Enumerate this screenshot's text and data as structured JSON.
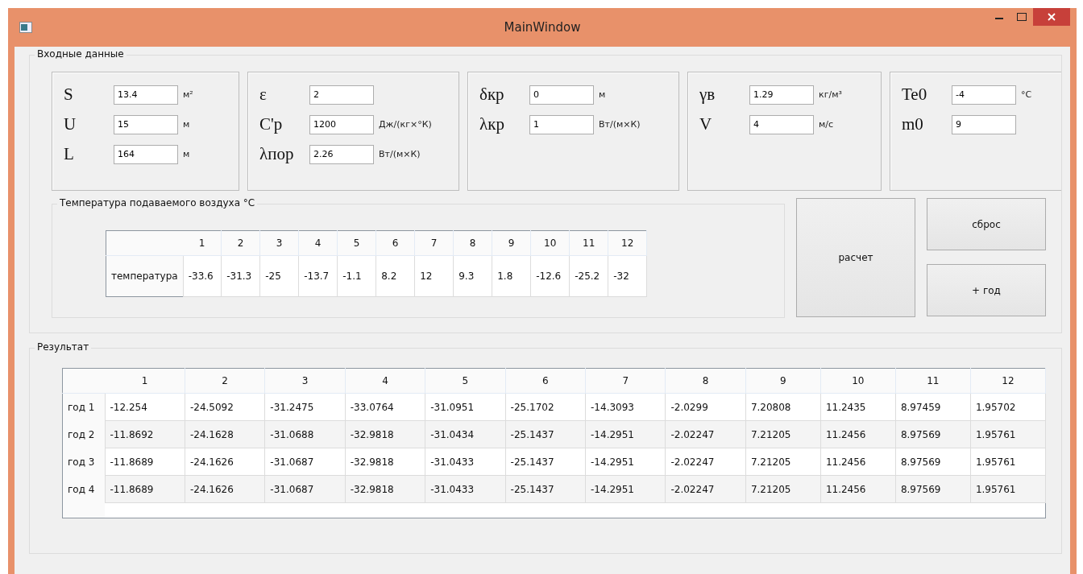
{
  "window": {
    "title": "MainWindow"
  },
  "input_section": {
    "title": "Входные данные",
    "panels": [
      {
        "fields": [
          {
            "label": "S",
            "value": "13.4",
            "unit": "м²"
          },
          {
            "label": "U",
            "value": "15",
            "unit": "м"
          },
          {
            "label": "L",
            "value": "164",
            "unit": "м"
          }
        ]
      },
      {
        "fields": [
          {
            "label": "ε",
            "value": "2"
          },
          {
            "label": "C'p",
            "value": "1200",
            "unit": "Дж/(кг×°К)"
          },
          {
            "label": "λпор",
            "value": "2.26",
            "unit": "Вт/(м×К)"
          }
        ]
      },
      {
        "fields": [
          {
            "label": "δкр",
            "value": "0",
            "unit": "м"
          },
          {
            "label": "λкр",
            "value": "1",
            "unit": "Вт/(м×К)"
          }
        ]
      },
      {
        "fields": [
          {
            "label": "γв",
            "value": "1.29",
            "unit": "кг/м³"
          },
          {
            "label": "V",
            "value": "4",
            "unit": "м/с"
          }
        ]
      },
      {
        "fields": [
          {
            "label": "Te0",
            "value": "-4",
            "unit": "°C"
          },
          {
            "label": "m0",
            "value": "9"
          }
        ]
      }
    ],
    "temperature": {
      "title": "Температура подаваемого воздуха °C",
      "columns": [
        "1",
        "2",
        "3",
        "4",
        "5",
        "6",
        "7",
        "8",
        "9",
        "10",
        "11",
        "12"
      ],
      "row_label": "температура",
      "values": [
        "-33.6",
        "-31.3",
        "-25",
        "-13.7",
        "-1.1",
        "8.2",
        "12",
        "9.3",
        "1.8",
        "-12.6",
        "-25.2",
        "-32"
      ]
    },
    "buttons": {
      "calculate": "расчет",
      "reset": "сброс",
      "add_year": "+ год"
    }
  },
  "result": {
    "title": "Результат",
    "columns": [
      "1",
      "2",
      "3",
      "4",
      "5",
      "6",
      "7",
      "8",
      "9",
      "10",
      "11",
      "12"
    ],
    "rows": [
      {
        "label": "год 1",
        "values": [
          "-12.254",
          "-24.5092",
          "-31.2475",
          "-33.0764",
          "-31.0951",
          "-25.1702",
          "-14.3093",
          "-2.0299",
          "7.20808",
          "11.2435",
          "8.97459",
          "1.95702"
        ]
      },
      {
        "label": "год 2",
        "values": [
          "-11.8692",
          "-24.1628",
          "-31.0688",
          "-32.9818",
          "-31.0434",
          "-25.1437",
          "-14.2951",
          "-2.02247",
          "7.21205",
          "11.2456",
          "8.97569",
          "1.95761"
        ]
      },
      {
        "label": "год 3",
        "values": [
          "-11.8689",
          "-24.1626",
          "-31.0687",
          "-32.9818",
          "-31.0433",
          "-25.1437",
          "-14.2951",
          "-2.02247",
          "7.21205",
          "11.2456",
          "8.97569",
          "1.95761"
        ]
      },
      {
        "label": "год 4",
        "values": [
          "-11.8689",
          "-24.1626",
          "-31.0687",
          "-32.9818",
          "-31.0433",
          "-25.1437",
          "-14.2951",
          "-2.02247",
          "7.21205",
          "11.2456",
          "8.97569",
          "1.95761"
        ]
      }
    ]
  }
}
